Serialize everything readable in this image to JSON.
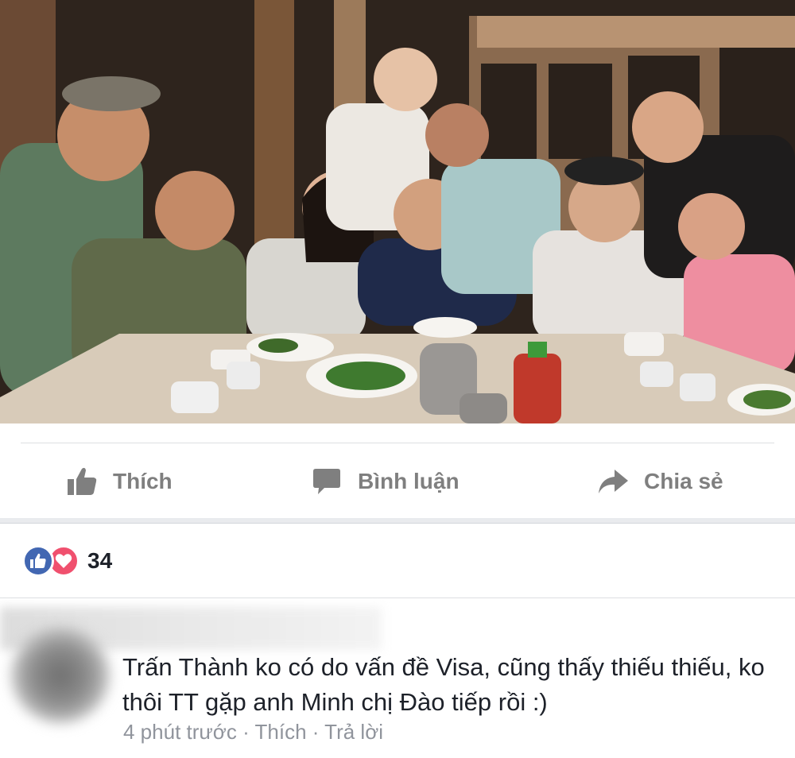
{
  "photo": {
    "alt": "group-photo"
  },
  "actions": {
    "like_label": "Thích",
    "comment_label": "Bình luận",
    "share_label": "Chia sẻ"
  },
  "reactions": {
    "count": "34",
    "types": [
      "like-icon",
      "heart-icon"
    ],
    "like_color": "#4267b2",
    "love_color": "#f0506e"
  },
  "comment": {
    "text": "Trấn Thành ko có do vấn đề Visa, cũng thấy thiếu thiếu, ko thôi TT gặp anh Minh chị Đào tiếp rồi :)",
    "time": "4 phút trước",
    "separator": " · ",
    "like_label": "Thích",
    "reply_label": "Trả lời"
  },
  "colors": {
    "action_gray": "#7f7f7f",
    "meta_gray": "#90949c",
    "divider": "#dddfe2"
  }
}
